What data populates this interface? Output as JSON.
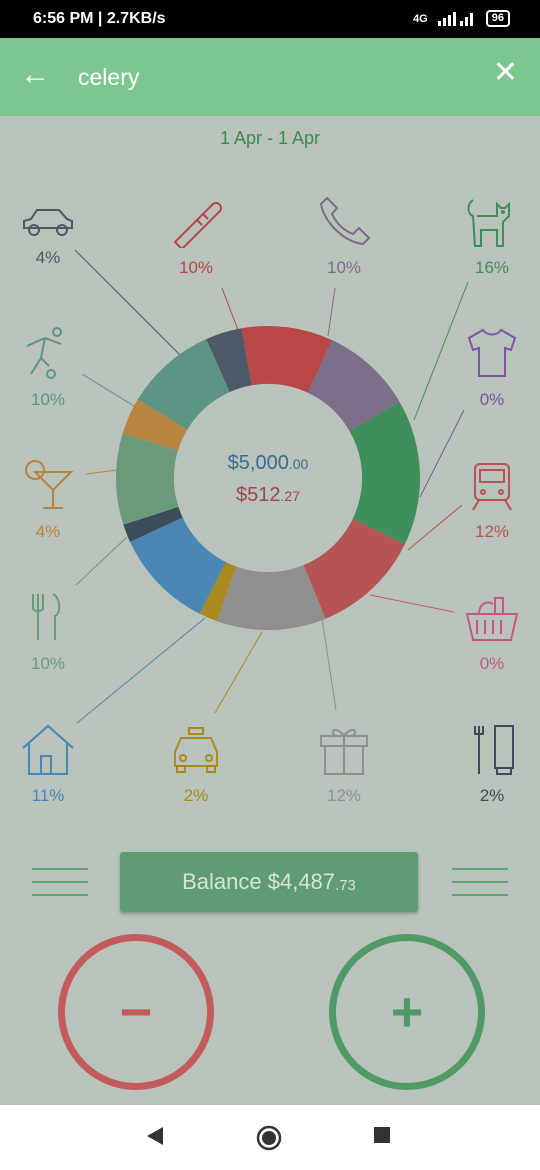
{
  "status": {
    "time_speed": "6:56 PM | 2.7KB/s",
    "network": "4G",
    "battery": "96"
  },
  "appbar": {
    "title": "celery",
    "back_icon": "arrow-left-icon",
    "close_icon": "close-icon"
  },
  "date_range": "1 Apr - 1 Apr",
  "donut": {
    "income_main": "$5,000",
    "income_cents": ".00",
    "expense_main": "$512",
    "expense_cents": ".27"
  },
  "categories": [
    {
      "icon": "car-icon",
      "percent": "4%",
      "color": "#4b5a66"
    },
    {
      "icon": "thermometer-icon",
      "percent": "10%",
      "color": "#b84747"
    },
    {
      "icon": "phone-icon",
      "percent": "10%",
      "color": "#7d6e8a"
    },
    {
      "icon": "cat-icon",
      "percent": "16%",
      "color": "#3f8f5c"
    },
    {
      "icon": "soccer-icon",
      "percent": "10%",
      "color": "#5c9485"
    },
    {
      "icon": "tshirt-icon",
      "percent": "0%",
      "color": "#7e56a0"
    },
    {
      "icon": "cocktail-icon",
      "percent": "4%",
      "color": "#b9843f"
    },
    {
      "icon": "train-icon",
      "percent": "12%",
      "color": "#b65353"
    },
    {
      "icon": "cutlery-icon",
      "percent": "10%",
      "color": "#6b9a7a"
    },
    {
      "icon": "grocery-basket-icon",
      "percent": "0%",
      "color": "#c45a7b"
    },
    {
      "icon": "house-icon",
      "percent": "11%",
      "color": "#4c86b5"
    },
    {
      "icon": "taxi-icon",
      "percent": "2%",
      "color": "#a88a1e"
    },
    {
      "icon": "gift-icon",
      "percent": "12%",
      "color": "#8f8f8f"
    },
    {
      "icon": "toiletries-icon",
      "percent": "2%",
      "color": "#3b4d59"
    }
  ],
  "balance": {
    "label": "Balance",
    "amount_main": "$4,487",
    "amount_cents": ".73"
  },
  "actions": {
    "minus_symbol": "−",
    "plus_symbol": "+"
  },
  "colors": {
    "appbar": "#7cc790",
    "background": "#b9c3bb",
    "income": "#3c6e91",
    "expense": "#9c4a4a"
  }
}
